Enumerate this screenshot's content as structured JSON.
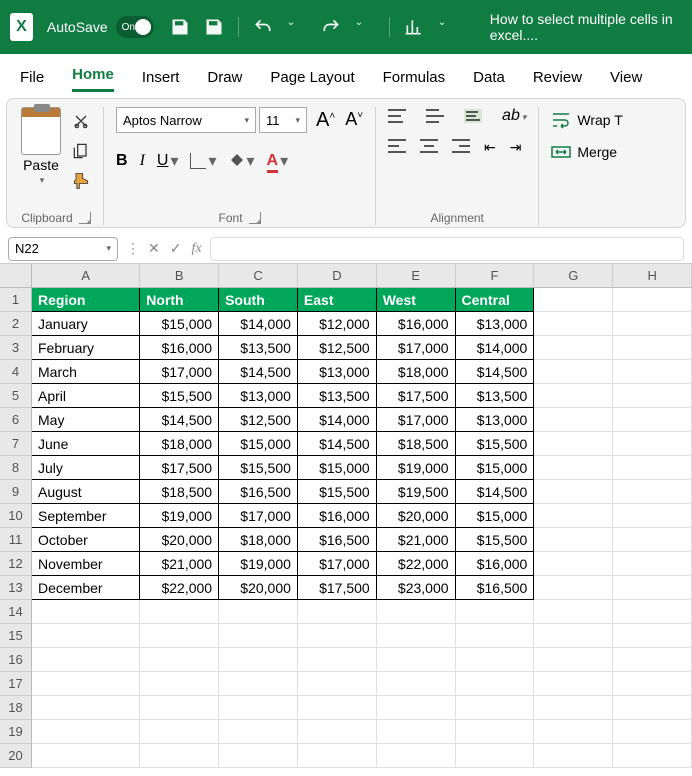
{
  "title": "How to select multiple cells in excel....",
  "autosave": "AutoSave",
  "autosave_state": "On",
  "menu": {
    "file": "File",
    "home": "Home",
    "insert": "Insert",
    "draw": "Draw",
    "page_layout": "Page Layout",
    "formulas": "Formulas",
    "data": "Data",
    "review": "Review",
    "view": "View"
  },
  "paste": "Paste",
  "font_name": "Aptos Narrow",
  "font_size": "11",
  "groups": {
    "clipboard": "Clipboard",
    "font": "Font",
    "alignment": "Alignment"
  },
  "wrap": "Wrap T",
  "merge": "Merge",
  "namebox": "N22",
  "cols": [
    "A",
    "B",
    "C",
    "D",
    "E",
    "F",
    "G",
    "H"
  ],
  "header_row": [
    "Region",
    "North",
    "South",
    "East",
    "West",
    "Central"
  ],
  "rows": [
    [
      "January",
      "$15,000",
      "$14,000",
      "$12,000",
      "$16,000",
      "$13,000"
    ],
    [
      "February",
      "$16,000",
      "$13,500",
      "$12,500",
      "$17,000",
      "$14,000"
    ],
    [
      "March",
      "$17,000",
      "$14,500",
      "$13,000",
      "$18,000",
      "$14,500"
    ],
    [
      "April",
      "$15,500",
      "$13,000",
      "$13,500",
      "$17,500",
      "$13,500"
    ],
    [
      "May",
      "$14,500",
      "$12,500",
      "$14,000",
      "$17,000",
      "$13,000"
    ],
    [
      "June",
      "$18,000",
      "$15,000",
      "$14,500",
      "$18,500",
      "$15,500"
    ],
    [
      "July",
      "$17,500",
      "$15,500",
      "$15,000",
      "$19,000",
      "$15,000"
    ],
    [
      "August",
      "$18,500",
      "$16,500",
      "$15,500",
      "$19,500",
      "$14,500"
    ],
    [
      "September",
      "$19,000",
      "$17,000",
      "$16,000",
      "$20,000",
      "$15,000"
    ],
    [
      "October",
      "$20,000",
      "$18,000",
      "$16,500",
      "$21,000",
      "$15,500"
    ],
    [
      "November",
      "$21,000",
      "$19,000",
      "$17,000",
      "$22,000",
      "$16,000"
    ],
    [
      "December",
      "$22,000",
      "$20,000",
      "$17,500",
      "$23,000",
      "$16,500"
    ]
  ]
}
